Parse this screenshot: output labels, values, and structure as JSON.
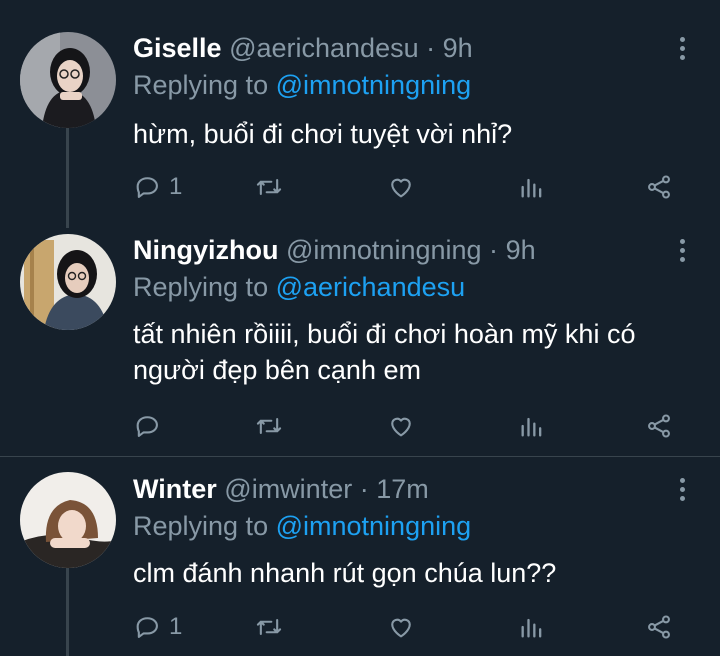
{
  "tweets": [
    {
      "name": "Giselle",
      "handle": "@aerichandesu",
      "separator": "·",
      "time": "9h",
      "replying_prefix": "Replying to",
      "replying_to": "@imnotningning",
      "body": "hừm, buổi đi chơi tuyệt vời nhỉ?",
      "reply_count": "1"
    },
    {
      "name": "Ningyizhou",
      "handle": "@imnotningning",
      "separator": "·",
      "time": "9h",
      "replying_prefix": "Replying to",
      "replying_to": "@aerichandesu",
      "body": "tất nhiên rồiiii, buổi đi chơi hoàn mỹ khi có người đẹp bên cạnh em",
      "reply_count": ""
    },
    {
      "name": "Winter",
      "handle": "@imwinter",
      "separator": "·",
      "time": "17m",
      "replying_prefix": "Replying to",
      "replying_to": "@imnotningning",
      "body": "clm đánh nhanh rút gọn chúa lun??",
      "reply_count": "1"
    }
  ],
  "colors": {
    "background": "#15202b",
    "muted": "#8899a6",
    "mention": "#1da1f2",
    "divider": "#38444d"
  },
  "icons": [
    "more-vertical-icon",
    "reply-icon",
    "retweet-icon",
    "like-icon",
    "analytics-icon",
    "share-icon"
  ]
}
